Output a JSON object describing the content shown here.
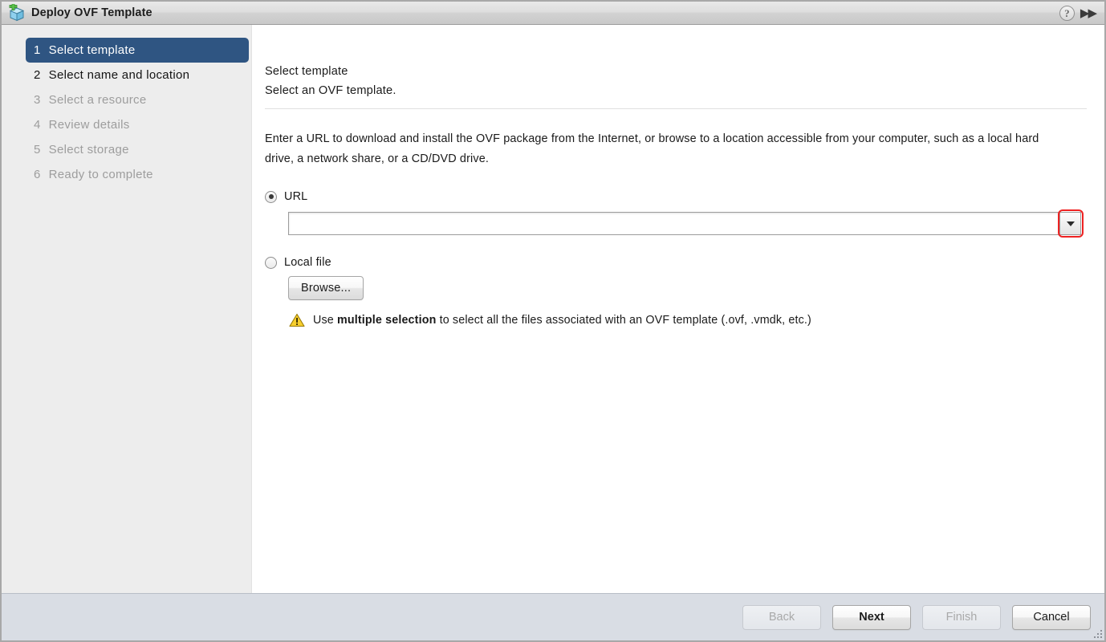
{
  "window": {
    "title": "Deploy OVF Template",
    "app_icon": "ovf-package-add-icon",
    "help_label": "?",
    "collapse_label": "▶▶"
  },
  "sidebar": {
    "steps": [
      {
        "num": "1",
        "label": "Select template",
        "state": "active"
      },
      {
        "num": "2",
        "label": "Select name and location",
        "state": "enabled"
      },
      {
        "num": "3",
        "label": "Select a resource",
        "state": "disabled"
      },
      {
        "num": "4",
        "label": "Review details",
        "state": "disabled"
      },
      {
        "num": "5",
        "label": "Select storage",
        "state": "disabled"
      },
      {
        "num": "6",
        "label": "Ready to complete",
        "state": "disabled"
      }
    ]
  },
  "content": {
    "heading": "Select template",
    "subheading": "Select an OVF template.",
    "intro": "Enter a URL to download and install the OVF package from the Internet, or browse to a location accessible from your computer, such as a local hard drive, a network share, or a CD/DVD drive.",
    "url_option": {
      "label": "URL",
      "selected": true,
      "value": "",
      "placeholder": "",
      "dropdown_icon": "chevron-down-icon",
      "highlighted": true,
      "highlight_color": "#ee2222"
    },
    "local_file_option": {
      "label": "Local file",
      "selected": false,
      "browse_label": "Browse..."
    },
    "warning": {
      "icon": "warning-triangle-icon",
      "text_before": "Use ",
      "text_bold": "multiple selection",
      "text_after": " to select all the files associated with an OVF template (.ovf, .vmdk, etc.)"
    }
  },
  "footer": {
    "buttons": [
      {
        "label": "Back",
        "enabled": false,
        "default": false
      },
      {
        "label": "Next",
        "enabled": true,
        "default": true
      },
      {
        "label": "Finish",
        "enabled": false,
        "default": false
      },
      {
        "label": "Cancel",
        "enabled": true,
        "default": false
      }
    ],
    "resize_grip": "resize-grip-icon"
  },
  "colors": {
    "active_step": "#2f5582",
    "sidebar_bg": "#ededed",
    "footer_bg": "#d9dde4",
    "highlight": "#ee2222",
    "warning": "#f2c500"
  }
}
